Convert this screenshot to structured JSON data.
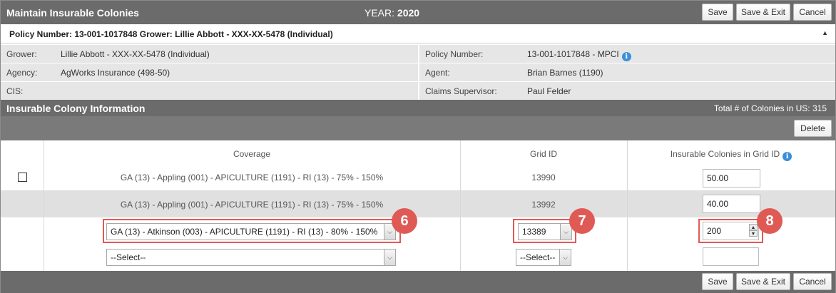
{
  "header": {
    "title": "Maintain Insurable Colonies",
    "year_label": "YEAR:",
    "year_value": "2020",
    "save_label": "Save",
    "save_exit_label": "Save & Exit",
    "cancel_label": "Cancel"
  },
  "policy_bar": {
    "text": "Policy Number: 13-001-1017848 Grower: Lillie Abbott - XXX-XX-5478 (Individual)",
    "collapse_glyph": "▲"
  },
  "info": {
    "grower_label": "Grower:",
    "grower_value": "Lillie Abbott - XXX-XX-5478 (Individual)",
    "policy_label": "Policy Number:",
    "policy_value": "13-001-1017848 - MPCI",
    "agency_label": "Agency:",
    "agency_value": "AgWorks Insurance (498-50)",
    "agent_label": "Agent:",
    "agent_value": "Brian Barnes (1190)",
    "cis_label": "CIS:",
    "cis_value": "",
    "claims_label": "Claims Supervisor:",
    "claims_value": "Paul Felder"
  },
  "section": {
    "title": "Insurable Colony Information",
    "total_text": "Total # of Colonies in US: 315",
    "delete_label": "Delete"
  },
  "table": {
    "col_coverage": "Coverage",
    "col_grid": "Grid ID",
    "col_colonies": "Insurable Colonies in Grid ID",
    "rows": [
      {
        "coverage": "GA (13) - Appling (001) - APICULTURE (1191) - RI (13) - 75% - 150%",
        "grid": "13990",
        "colonies": "50.00"
      },
      {
        "coverage": "GA (13) - Appling (001) - APICULTURE (1191) - RI (13) - 75% - 150%",
        "grid": "13992",
        "colonies": "40.00"
      }
    ],
    "edit_row": {
      "coverage": "GA (13) - Atkinson (003) - APICULTURE (1191) - RI (13) - 80% - 150%",
      "grid": "13389",
      "colonies": "200"
    },
    "new_row": {
      "coverage": "--Select--",
      "grid": "--Select--",
      "colonies": ""
    }
  },
  "callouts": {
    "six": "6",
    "seven": "7",
    "eight": "8"
  },
  "icons": {
    "info": "i",
    "dropdown": "⌵",
    "spin_up": "▲",
    "spin_down": "▼"
  },
  "colors": {
    "header_bg": "#6b6b6b",
    "callout": "#e05a55",
    "info_icon": "#3a8fd9"
  }
}
